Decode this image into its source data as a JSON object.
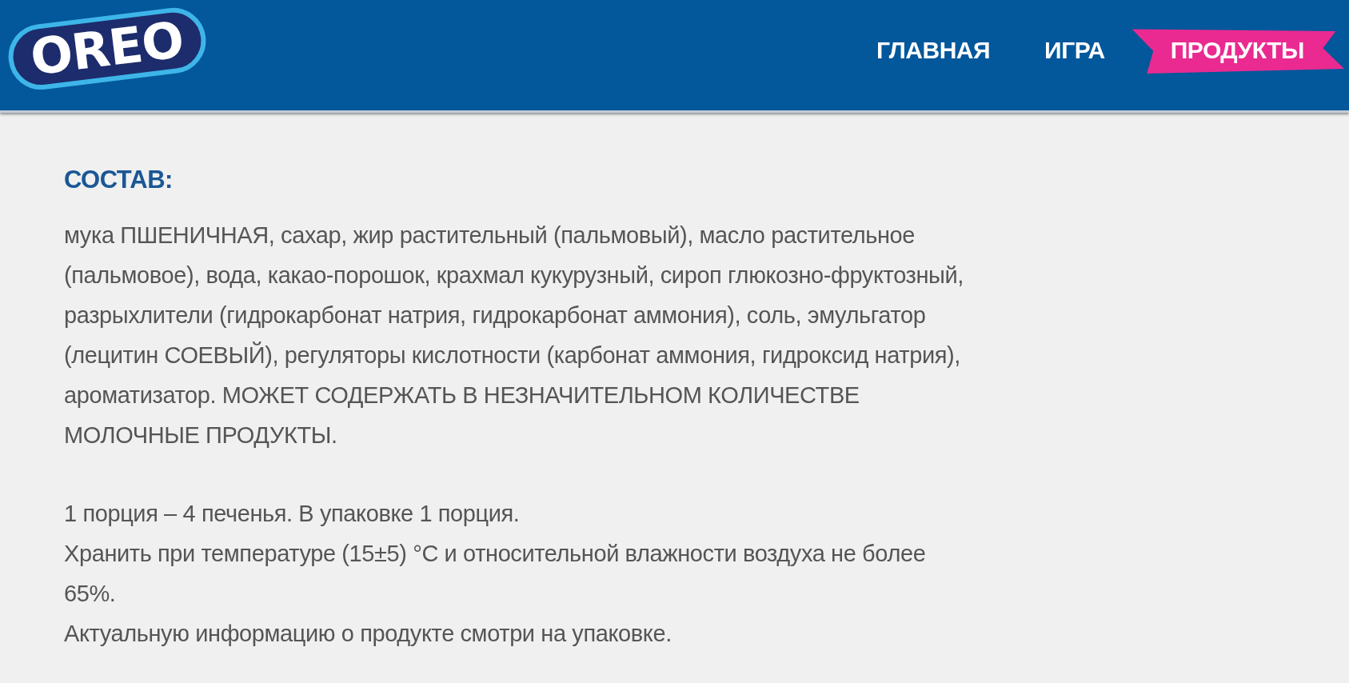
{
  "header": {
    "logo": "OREO",
    "nav": [
      {
        "label": "ГЛАВНАЯ",
        "selected": false
      },
      {
        "label": "ИГРА",
        "selected": false
      },
      {
        "label": "ПРОДУКТЫ",
        "selected": true
      }
    ]
  },
  "content": {
    "heading": "СОСТАВ:",
    "ingredients": "мука ПШЕНИЧНАЯ, сахар, жир растительный (пальмовый), масло растительное (пальмовое), вода, какао-порошок, крахмал кукурузный, сироп глюкозно-фруктозный, разрыхлители (гидрокарбонат натрия, гидрокарбонат аммония), соль, эмульгатор (лецитин СОЕВЫЙ), регуляторы кислотности (карбонат аммония, гидроксид натрия), ароматизатор. МОЖЕТ СОДЕРЖАТЬ В НЕЗНАЧИТЕЛЬНОМ КОЛИЧЕСТВЕ МОЛОЧНЫЕ ПРОДУКТЫ.",
    "notes": [
      "1 порция – 4 печенья. В упаковке 1 порция.",
      "Хранить при температуре (15±5) °C и относительной влажности воздуха не более 65%.",
      "Актуальную информацию о продукте смотри на упаковке."
    ]
  }
}
